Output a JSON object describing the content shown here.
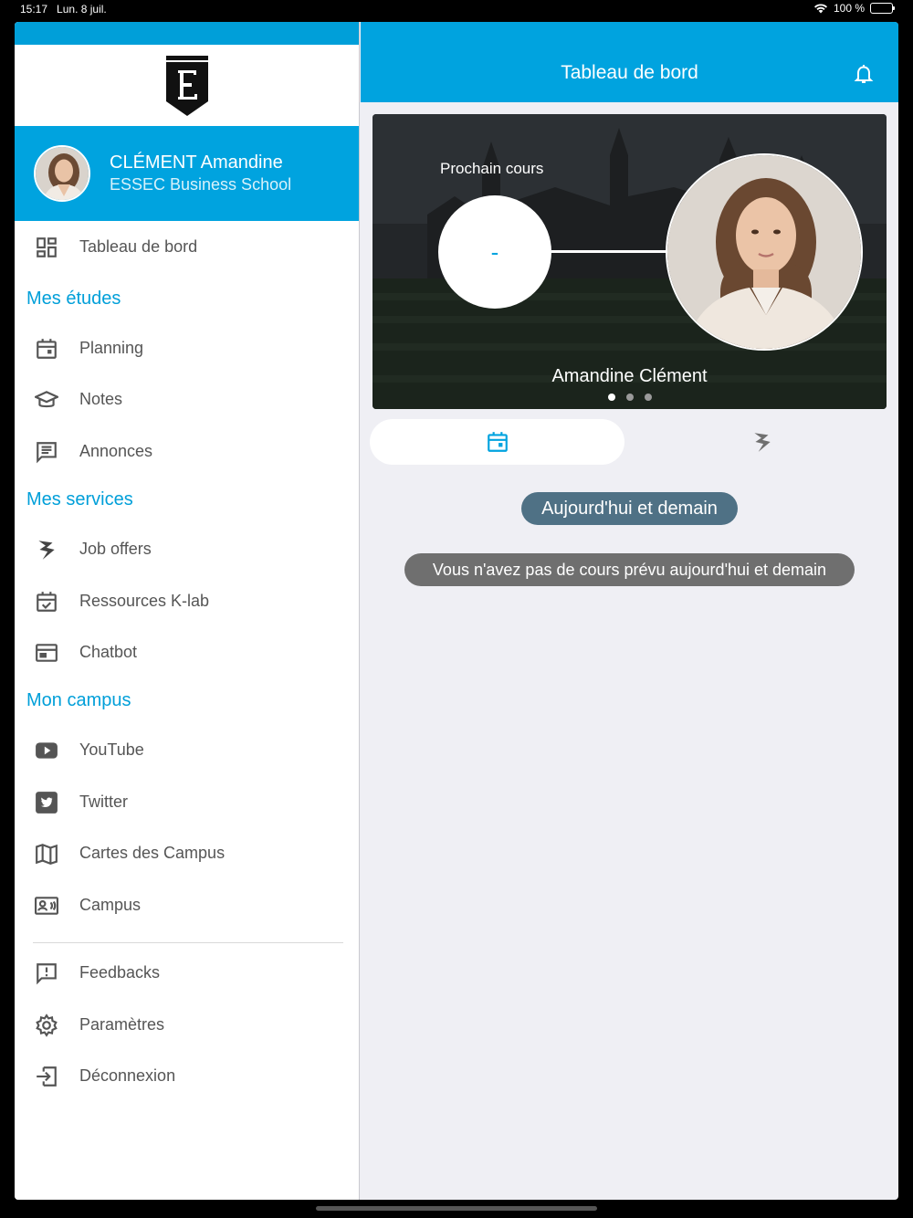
{
  "status_bar": {
    "time": "15:17",
    "date": "Lun. 8 juil.",
    "battery": "100 %"
  },
  "colors": {
    "brand": "#00a3df",
    "section": "#009fd9",
    "pill": "#4f7185"
  },
  "sidebar": {
    "profile": {
      "name": "CLÉMENT Amandine",
      "school": "ESSEC Business School"
    },
    "dashboard": {
      "label": "Tableau de bord",
      "icon": "dashboard-icon"
    },
    "sections": [
      {
        "title": "Mes études",
        "items": [
          {
            "label": "Planning",
            "icon": "calendar-icon"
          },
          {
            "label": "Notes",
            "icon": "graduation-cap-icon"
          },
          {
            "label": "Annonces",
            "icon": "announcements-icon"
          }
        ]
      },
      {
        "title": "Mes services",
        "items": [
          {
            "label": "Job offers",
            "icon": "job-offers-icon"
          },
          {
            "label": "Ressources K-lab",
            "icon": "calendar-check-icon"
          },
          {
            "label": "Chatbot",
            "icon": "chatbot-icon"
          }
        ]
      },
      {
        "title": "Mon campus",
        "items": [
          {
            "label": "YouTube",
            "icon": "youtube-icon"
          },
          {
            "label": "Twitter",
            "icon": "twitter-icon"
          },
          {
            "label": "Cartes des Campus",
            "icon": "map-icon"
          },
          {
            "label": "Campus",
            "icon": "contact-card-icon"
          }
        ]
      }
    ],
    "footer_items": [
      {
        "label": "Feedbacks",
        "icon": "feedback-icon"
      },
      {
        "label": "Paramètres",
        "icon": "gear-icon"
      },
      {
        "label": "Déconnexion",
        "icon": "logout-icon"
      }
    ]
  },
  "main": {
    "header_title": "Tableau de bord",
    "hero": {
      "label": "Prochain cours",
      "next_course": "-",
      "name": "Amandine Clément",
      "slides": 3,
      "active_slide": 1
    },
    "tabs": [
      {
        "icon": "calendar-icon",
        "active": true
      },
      {
        "icon": "job-offers-icon",
        "active": false
      }
    ],
    "date_pill": "Aujourd'hui et demain",
    "info_message": "Vous n'avez pas de cours prévu aujourd'hui et demain"
  }
}
